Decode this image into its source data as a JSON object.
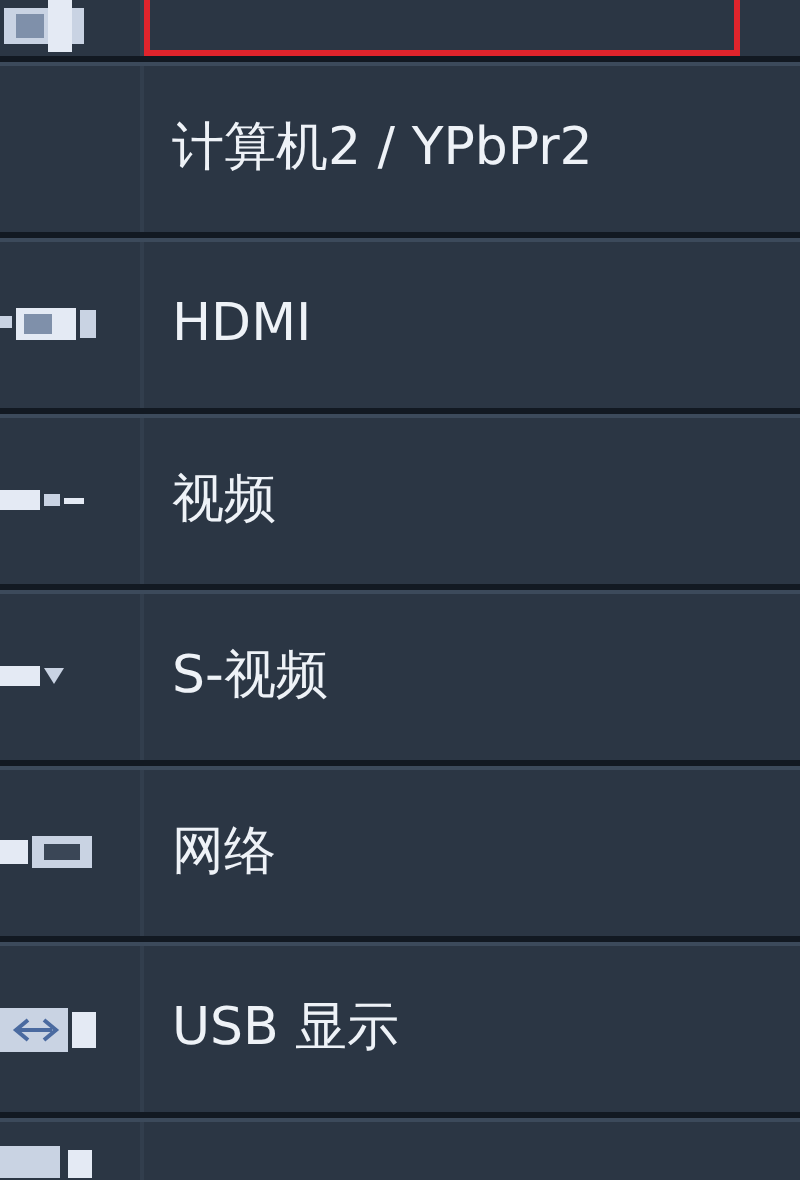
{
  "source_menu": {
    "items": [
      {
        "selected": true
      },
      {
        "label": "计算机2 / YPbPr2",
        "selected": false
      },
      {
        "label": "HDMI",
        "selected": false
      },
      {
        "label": "视频",
        "selected": false
      },
      {
        "label": "S-视频",
        "selected": false
      },
      {
        "label": "网络",
        "selected": false
      },
      {
        "label": "USB 显示",
        "selected": false
      },
      {
        "selected": false
      }
    ]
  }
}
